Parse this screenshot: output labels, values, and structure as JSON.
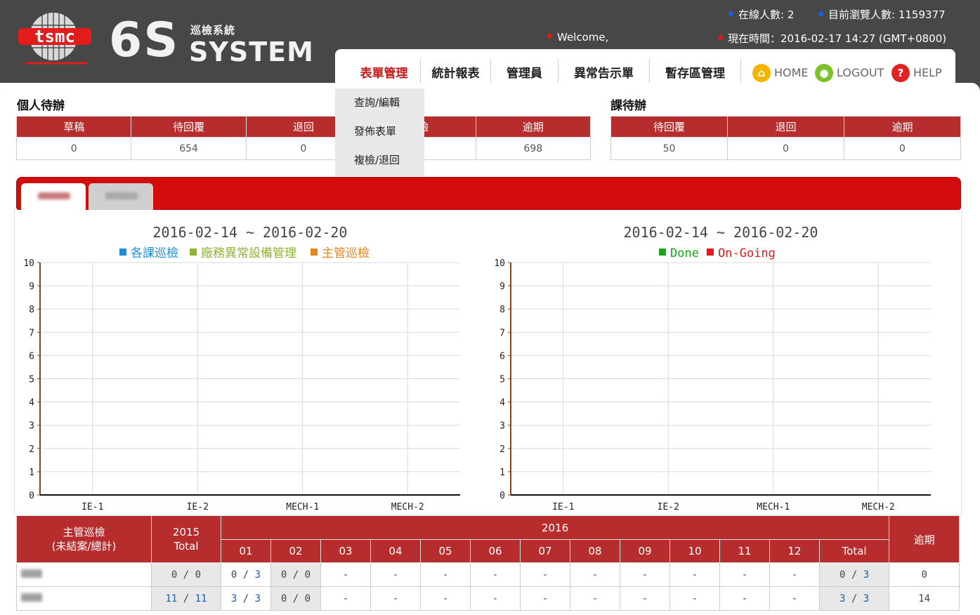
{
  "header": {
    "brand_logo": "tsmc",
    "system_big": "6S",
    "system_sub": "巡檢系統",
    "system_name": "SYSTEM",
    "online_label": "在線人數: 2",
    "visitors_label": "目前瀏覽人數: 1159377",
    "welcome": "Welcome,",
    "time_label": "現在時間：2016-02-17 14:27 (GMT+0800)"
  },
  "nav": {
    "items": [
      "表單管理",
      "統計報表",
      "管理員",
      "異常告示單",
      "暫存區管理"
    ],
    "home": "HOME",
    "logout": "LOGOUT",
    "help": "HELP"
  },
  "dropdown": [
    "查詢/編輯",
    "發佈表單",
    "複檢/退回"
  ],
  "personal": {
    "title": "個人待辦",
    "headers": [
      "草稿",
      "待回覆",
      "退回",
      "複檢",
      "逾期"
    ],
    "values": [
      "0",
      "654",
      "0",
      "-",
      "698"
    ]
  },
  "section": {
    "title": "課待辦",
    "headers": [
      "待回覆",
      "退回",
      "逾期"
    ],
    "values": [
      "50",
      "0",
      "0"
    ]
  },
  "chart_data": [
    {
      "type": "bar",
      "title": "2016-02-14 ~ 2016-02-20",
      "categories": [
        "IE-1",
        "IE-2",
        "MECH-1",
        "MECH-2"
      ],
      "series": [
        {
          "name": "各課巡檢",
          "color": "#1e8fd6",
          "values": [
            0,
            0,
            0,
            0
          ]
        },
        {
          "name": "廠務異常設備管理",
          "color": "#8fb432",
          "values": [
            0,
            0,
            0,
            0
          ]
        },
        {
          "name": "主管巡檢",
          "color": "#e8861e",
          "values": [
            0,
            0,
            0,
            0
          ]
        }
      ],
      "ylim": [
        0,
        10
      ],
      "yticks": [
        "0",
        "1",
        "2",
        "3",
        "4",
        "5",
        "6",
        "7",
        "8",
        "9",
        "10"
      ],
      "grid": true,
      "legend": "top"
    },
    {
      "type": "bar",
      "title": "2016-02-14 ~ 2016-02-20",
      "categories": [
        "IE-1",
        "IE-2",
        "MECH-1",
        "MECH-2"
      ],
      "series": [
        {
          "name": "Done",
          "color": "#1aa51a",
          "values": [
            0,
            0,
            0,
            0
          ]
        },
        {
          "name": "On-Going",
          "color": "#e01a1a",
          "values": [
            0,
            0,
            0,
            0
          ]
        }
      ],
      "ylim": [
        0,
        10
      ],
      "yticks": [
        "0",
        "1",
        "2",
        "3",
        "4",
        "5",
        "6",
        "7",
        "8",
        "9",
        "10"
      ],
      "grid": true,
      "legend": "top"
    }
  ],
  "stats": {
    "head_main": "主管巡檢\n(未結案/總計)",
    "head_2015": "2015\nTotal",
    "head_2016": "2016",
    "head_overdue": "逾期",
    "months": [
      "01",
      "02",
      "03",
      "04",
      "05",
      "06",
      "07",
      "08",
      "09",
      "10",
      "11",
      "12"
    ],
    "head_total": "Total",
    "rows": [
      {
        "t2015": [
          "0",
          "0"
        ],
        "months": [
          [
            "0",
            "3"
          ],
          [
            "0",
            "0"
          ],
          "-",
          "-",
          "-",
          "-",
          "-",
          "-",
          "-",
          "-",
          "-",
          "-"
        ],
        "total": [
          "0",
          "3"
        ],
        "overdue": "0"
      },
      {
        "t2015": [
          "11",
          "11"
        ],
        "months": [
          [
            "3",
            "3"
          ],
          [
            "0",
            "0"
          ],
          "-",
          "-",
          "-",
          "-",
          "-",
          "-",
          "-",
          "-",
          "-",
          "-"
        ],
        "total": [
          "3",
          "3"
        ],
        "overdue": "14"
      }
    ]
  }
}
